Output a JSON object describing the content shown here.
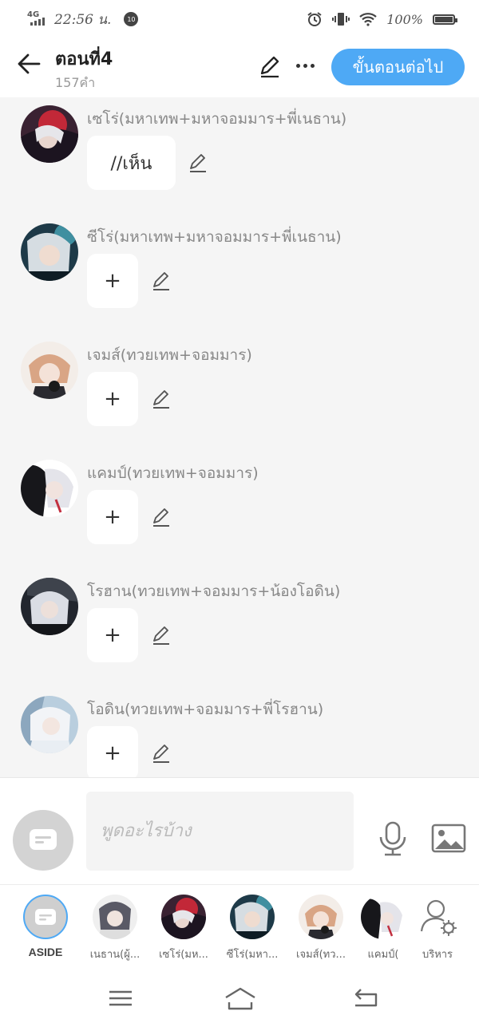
{
  "status": {
    "network": "4G",
    "time": "22:56 น.",
    "notification_count": "10",
    "battery": "100%"
  },
  "header": {
    "title": "ตอนที่4",
    "word_count": "157คำ",
    "next_label": "ขั้นตอนต่อไป"
  },
  "messages": [
    {
      "name": "เซโร่(มหาเทพ+มหาจอมมาร+พี่เนธาน)",
      "text": "//เห็น"
    },
    {
      "name": "ซีโร่(มหาเทพ+มหาจอมมาร+พี่เนธาน)",
      "text": "+"
    },
    {
      "name": "เจมส์(ทวยเทพ+จอมมาร)",
      "text": "+"
    },
    {
      "name": "แคมป์(ทวยเทพ+จอมมาร)",
      "text": "+"
    },
    {
      "name": "โรฮาน(ทวยเทพ+จอมมาร+น้องโอดิน)",
      "text": "+"
    },
    {
      "name": "โอดิน(ทวยเทพ+จอมมาร+พี่โรฮาน)",
      "text": "+"
    }
  ],
  "input": {
    "placeholder": "พูดอะไรบ้าง"
  },
  "character_bar": [
    {
      "label": "ASIDE"
    },
    {
      "label": "เนธาน(ผู้..."
    },
    {
      "label": "เซโร่(มห..."
    },
    {
      "label": "ซีโร่(มหา..."
    },
    {
      "label": "เจมส์(ทว..."
    },
    {
      "label": "แคมป์("
    },
    {
      "label": "บริหาร"
    }
  ],
  "colors": {
    "accent": "#4ea9f5",
    "background": "#f5f5f5"
  }
}
